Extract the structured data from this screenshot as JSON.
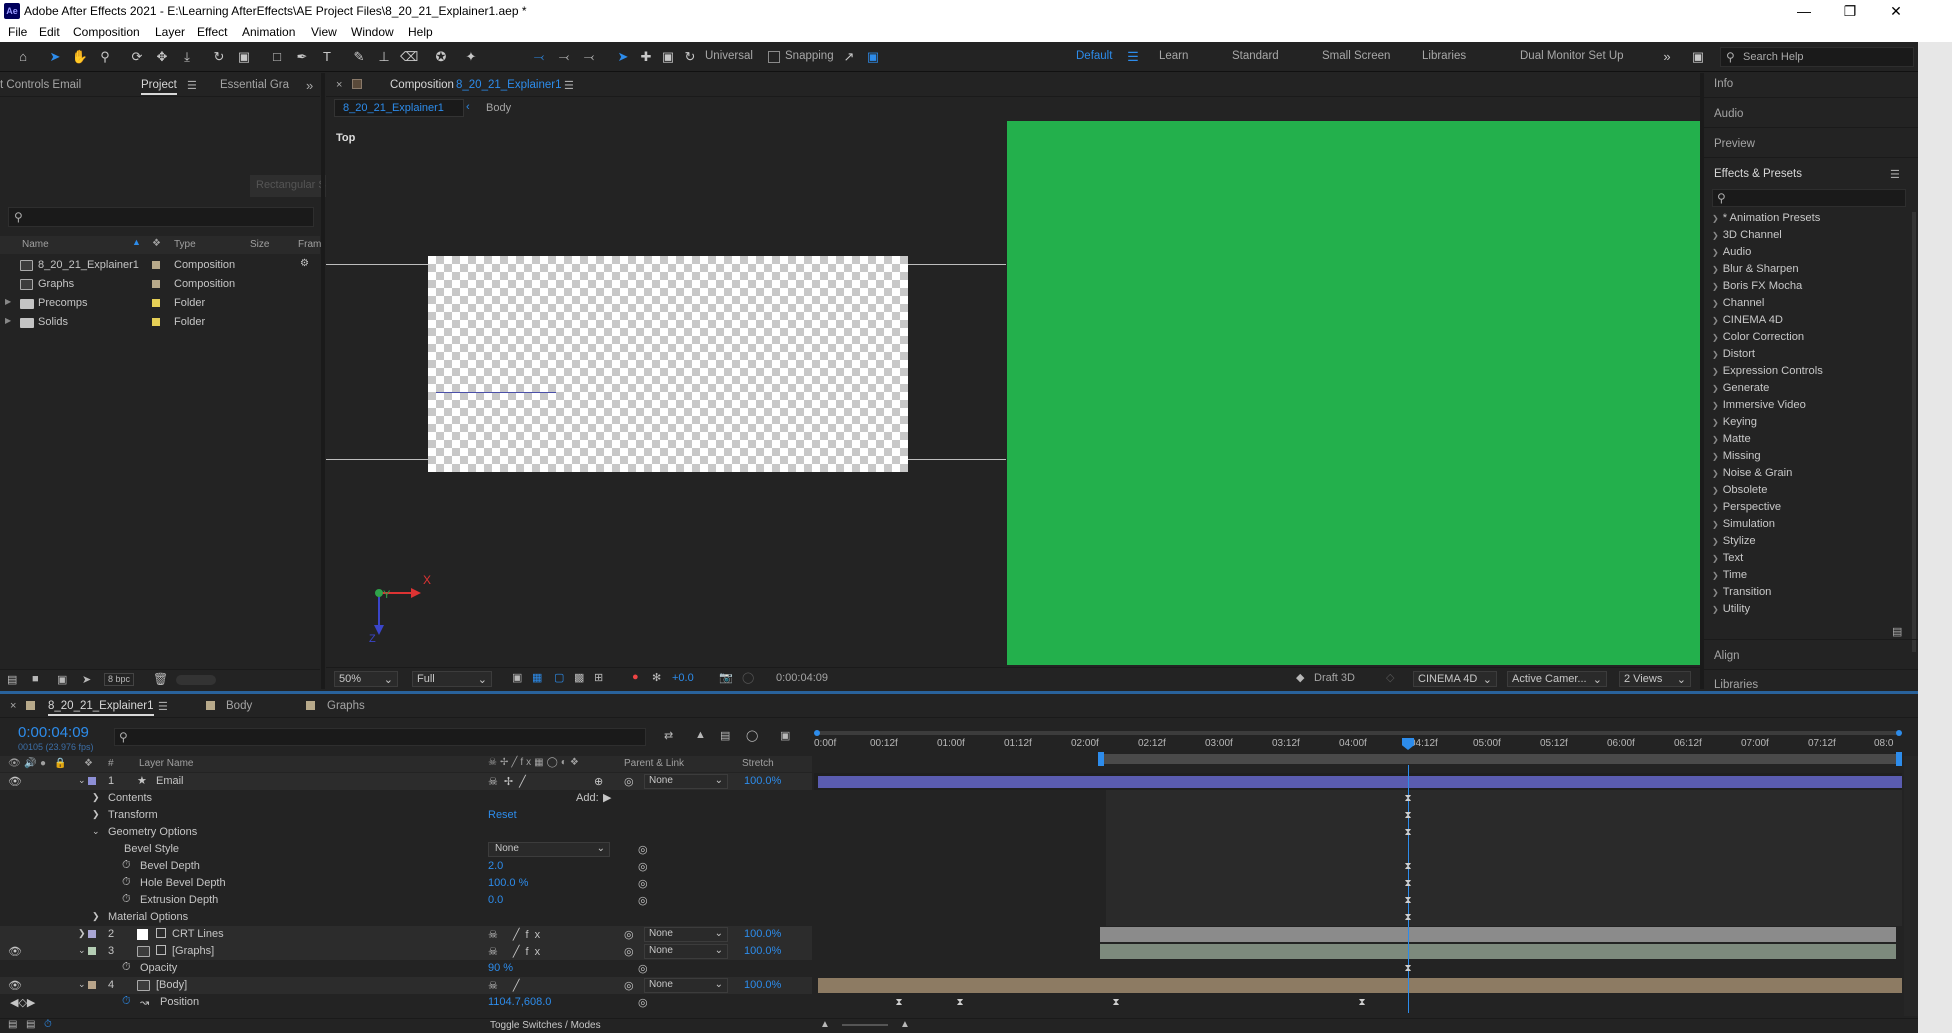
{
  "window": {
    "app_icon": "Ae",
    "title": "Adobe After Effects 2021 - E:\\Learning AfterEffects\\AE Project Files\\8_20_21_Explainer1.aep *",
    "controls": [
      "minimize-icon",
      "restore-icon",
      "close-icon"
    ]
  },
  "menu": [
    "File",
    "Edit",
    "Composition",
    "Layer",
    "Effect",
    "Animation",
    "View",
    "Window",
    "Help"
  ],
  "toolbar": {
    "tools": [
      "home-icon",
      "selection-tool-icon",
      "hand-tool-icon",
      "zoom-tool-icon",
      "orbit-camera-icon",
      "pan-camera-icon",
      "dolly-camera-icon",
      "rotation-tool-icon",
      "pan-behind-icon",
      "rectangle-tool-icon",
      "pen-tool-icon",
      "type-tool-icon",
      "brush-tool-icon",
      "clone-stamp-icon",
      "eraser-tool-icon",
      "roto-brush-icon",
      "puppet-pin-icon"
    ],
    "axis_label": "Universal",
    "snapping_label": "Snapping",
    "workspaces": [
      "Default",
      "Learn",
      "Standard",
      "Small Screen",
      "Libraries",
      "Dual Monitor Set Up"
    ],
    "active_workspace": "Default",
    "search_placeholder": "Search Help"
  },
  "project_panel": {
    "tabs": [
      "t Controls Email",
      "Project",
      "Essential Gra"
    ],
    "active_tab": "Project",
    "ghost_label": "Rectangular Snap",
    "columns": [
      "Name",
      "Type",
      "Size",
      "Fram"
    ],
    "items": [
      {
        "name": "8_20_21_Explainer1",
        "type": "Composition",
        "icon": "composition-icon",
        "color": "#b7a98a"
      },
      {
        "name": "Graphs",
        "type": "Composition",
        "icon": "composition-icon",
        "color": "#b7a98a"
      },
      {
        "name": "Precomps",
        "type": "Folder",
        "icon": "folder-icon",
        "color": "#e5cf56"
      },
      {
        "name": "Solids",
        "type": "Folder",
        "icon": "folder-icon",
        "color": "#e5cf56"
      }
    ],
    "footer_bpc": "8 bpc"
  },
  "comp_viewer": {
    "tab_label": "Composition",
    "tab_comp": "8_20_21_Explainer1",
    "breadcrumb": [
      "8_20_21_Explainer1",
      "Body"
    ],
    "view_label": "Top",
    "axis_x": "X",
    "axis_y": "Y",
    "axis_z": "Z",
    "zoom": "50%",
    "resolution": "Full",
    "exposure": "+0.0",
    "timecode": "0:00:04:09",
    "renderer_label": "Draft 3D",
    "renderer": "CINEMA 4D",
    "camera": "Active Camer...",
    "views": "2 Views",
    "right_view_color": "#23b04c"
  },
  "right_panels": {
    "collapsed": [
      "Info",
      "Audio",
      "Preview"
    ],
    "effects_title": "Effects & Presets",
    "effects": [
      "* Animation Presets",
      "3D Channel",
      "Audio",
      "Blur & Sharpen",
      "Boris FX Mocha",
      "Channel",
      "CINEMA 4D",
      "Color Correction",
      "Distort",
      "Expression Controls",
      "Generate",
      "Immersive Video",
      "Keying",
      "Matte",
      "Missing",
      "Noise & Grain",
      "Obsolete",
      "Perspective",
      "Simulation",
      "Stylize",
      "Text",
      "Time",
      "Transition",
      "Utility"
    ],
    "bottom": [
      "Align",
      "Libraries"
    ]
  },
  "timeline": {
    "tabs": [
      "8_20_21_Explainer1",
      "Body",
      "Graphs"
    ],
    "timecode": "0:00:04:09",
    "frame_info": "00105 (23.976 fps)",
    "headers": {
      "num": "#",
      "layer_name": "Layer Name",
      "parent": "Parent & Link",
      "stretch": "Stretch"
    },
    "ruler": [
      "0:00f",
      "00:12f",
      "01:00f",
      "01:12f",
      "02:00f",
      "02:12f",
      "03:00f",
      "03:12f",
      "04:00f",
      "04:12f",
      "05:00f",
      "05:12f",
      "06:00f",
      "06:12f",
      "07:00f",
      "07:12f",
      "08:0"
    ],
    "playhead_time": "04:09",
    "add_label": "Add:",
    "reset_label": "Reset",
    "layers": [
      {
        "num": "1",
        "name": "Email",
        "color": "#8d8fd6",
        "parent": "None",
        "stretch": "100.0%",
        "bar_color": "#5a5cb0"
      },
      {
        "name": "Contents",
        "type": "group"
      },
      {
        "name": "Transform",
        "type": "group"
      },
      {
        "name": "Geometry Options",
        "type": "group"
      },
      {
        "name": "Bevel Style",
        "value": "None"
      },
      {
        "name": "Bevel Depth",
        "value": "2.0"
      },
      {
        "name": "Hole Bevel Depth",
        "value": "100.0 %"
      },
      {
        "name": "Extrusion Depth",
        "value": "0.0"
      },
      {
        "name": "Material Options",
        "type": "group"
      },
      {
        "num": "2",
        "name": "CRT Lines",
        "color": "#a9a6d4",
        "parent": "None",
        "stretch": "100.0%"
      },
      {
        "num": "3",
        "name": "[Graphs]",
        "color": "#b4cdb4",
        "parent": "None",
        "stretch": "100.0%"
      },
      {
        "name": "Opacity",
        "value": "90 %"
      },
      {
        "num": "4",
        "name": "[Body]",
        "color": "#b8a48a",
        "parent": "None",
        "stretch": "100.0%"
      },
      {
        "name": "Position",
        "value": "1104.7,608.0"
      }
    ],
    "footer_label": "Toggle Switches / Modes"
  }
}
